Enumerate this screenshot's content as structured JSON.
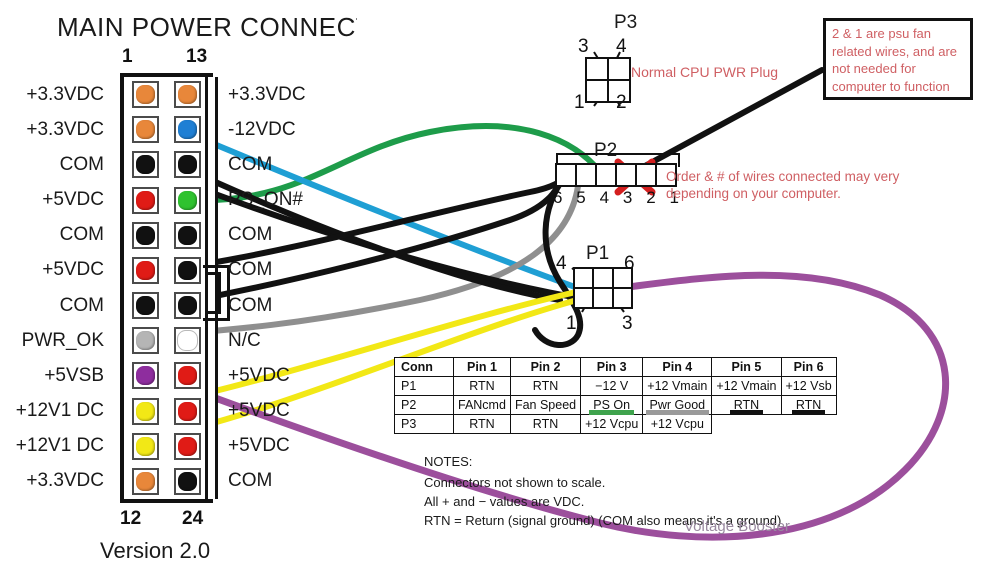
{
  "title": "MAIN POWER CONNECTO",
  "version": "Version 2.0",
  "main_connector": {
    "top_numbers": {
      "left": "1",
      "right": "13"
    },
    "bottom_numbers": {
      "left": "12",
      "right": "24"
    },
    "left_labels": [
      "+3.3VDC",
      "+3.3VDC",
      "COM",
      "+5VDC",
      "COM",
      "+5VDC",
      "COM",
      "PWR_OK",
      "+5VSB",
      "+12V1 DC",
      "+12V1 DC",
      "+3.3VDC"
    ],
    "right_labels": [
      "+3.3VDC",
      "-12VDC",
      "COM",
      "PS_ON#",
      "COM",
      "COM",
      "COM",
      "N/C",
      "+5VDC",
      "+5VDC",
      "+5VDC",
      "COM"
    ],
    "pin_colors_left": [
      "#e8873a",
      "#e8873a",
      "#111111",
      "#e01b16",
      "#111111",
      "#e01b16",
      "#111111",
      "#b5b5b5",
      "#8e2d9e",
      "#f2e816",
      "#f2e816",
      "#e8873a"
    ],
    "pin_colors_right": [
      "#e8873a",
      "#1f7fd4",
      "#111111",
      "#2fc22f",
      "#111111",
      "#111111",
      "#111111",
      "#ffffff",
      "#e01b16",
      "#e01b16",
      "#e01b16",
      "#111111"
    ]
  },
  "connectors": {
    "p3": {
      "label": "P3",
      "pins": [
        "3",
        "4",
        "1",
        "2"
      ]
    },
    "p2": {
      "label": "P2",
      "pins": [
        "6",
        "5",
        "4",
        "3",
        "2",
        "1"
      ]
    },
    "p1": {
      "label": "P1",
      "pins": [
        "4",
        "6",
        "1",
        "3"
      ]
    }
  },
  "annotations": {
    "cpu_plug": "Normal CPU PWR Plug",
    "order_note": "Order & # of wires connected may very depending on your computer.",
    "fan_note": "2 & 1 are psu fan related wires, and are not needed for computer to function",
    "voltage_booster": "Voltage Booster"
  },
  "pin_table": {
    "headers": [
      "Conn",
      "Pin 1",
      "Pin 2",
      "Pin 3",
      "Pin 4",
      "Pin 5",
      "Pin 6"
    ],
    "rows": [
      {
        "conn": "P1",
        "cells": [
          "RTN",
          "RTN",
          "−12 V",
          "+12 Vmain",
          "+12 Vmain",
          "+12 Vsb"
        ],
        "highlights": [
          "",
          "",
          "",
          "",
          "",
          ""
        ]
      },
      {
        "conn": "P2",
        "cells": [
          "FANcmd",
          "Fan Speed",
          "PS On",
          "Pwr Good",
          "RTN",
          "RTN"
        ],
        "highlights": [
          "",
          "",
          "green",
          "gray",
          "black",
          "black"
        ]
      },
      {
        "conn": "P3",
        "cells": [
          "RTN",
          "RTN",
          "+12 Vcpu",
          "+12 Vcpu",
          "",
          ""
        ],
        "highlights": [
          "",
          "",
          "",
          "",
          "",
          ""
        ]
      }
    ]
  },
  "notes": {
    "heading": "NOTES:",
    "lines": [
      "Connectors not shown to scale.",
      "All + and − values are VDC.",
      "RTN = Return (signal ground) (COM also means it's a ground)"
    ]
  },
  "wire_colors": {
    "green": "#1e9c4a",
    "blue": "#1f9fd4",
    "black": "#111111",
    "gray": "#8f8f8f",
    "yellow": "#f2e816",
    "purple": "#9c4f9c",
    "red_x": "#d41f1f"
  }
}
